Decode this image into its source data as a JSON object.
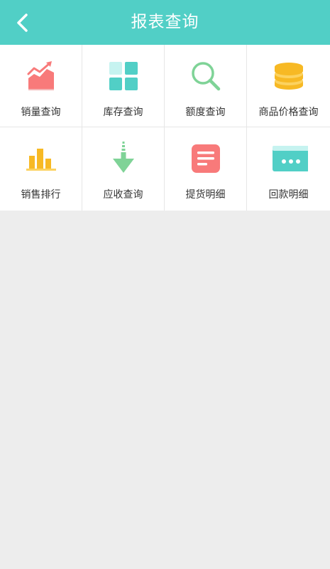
{
  "header": {
    "title": "报表查询",
    "back_icon": "chevron-left-icon",
    "color": "#51cfc6"
  },
  "menu": [
    {
      "label": "销量查询",
      "icon": "trend-chart-icon",
      "color": "#f87a7a"
    },
    {
      "label": "库存查询",
      "icon": "grid-blocks-icon",
      "color": "#51cfc6"
    },
    {
      "label": "额度查询",
      "icon": "magnifier-icon",
      "color": "#7fd397"
    },
    {
      "label": "商品价格查询",
      "icon": "coin-stack-icon",
      "color": "#f7b924"
    },
    {
      "label": "销售排行",
      "icon": "bar-chart-icon",
      "color": "#f7b924"
    },
    {
      "label": "应收查询",
      "icon": "arrow-down-icon",
      "color": "#7fd397"
    },
    {
      "label": "提货明细",
      "icon": "document-list-icon",
      "color": "#f87a7a"
    },
    {
      "label": "回款明细",
      "icon": "card-icon",
      "color": "#51cfc6"
    }
  ]
}
